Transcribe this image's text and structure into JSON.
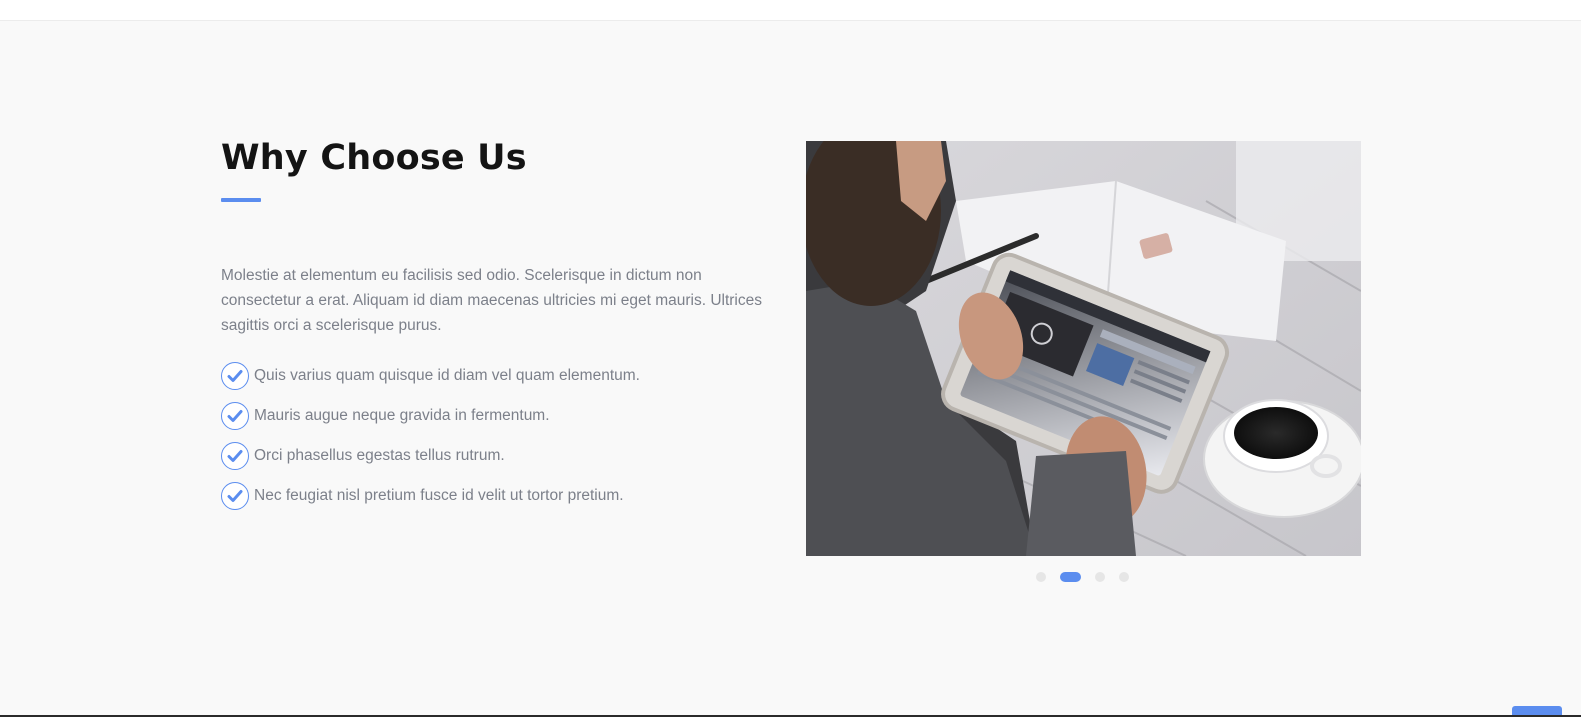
{
  "section": {
    "title": "Why Choose Us",
    "intro": "Molestie at elementum eu facilisis sed odio. Scelerisque in dictum non consectetur a erat. Aliquam id diam maecenas ultricies mi eget mauris. Ultrices sagittis orci a scelerisque purus.",
    "features": [
      "Quis varius quam quisque id diam vel quam elementum.",
      "Mauris augue neque gravida in fermentum.",
      "Orci phasellus egestas tellus rutrum.",
      "Nec feugiat nisl pretium fusce id velit ut tortor pretium."
    ]
  },
  "slider": {
    "slide_count": 4,
    "active_slide": 2
  },
  "colors": {
    "accent": "#5b8def",
    "heading": "#141414",
    "body_text": "#7c808a",
    "background": "#f9f9f9"
  },
  "icons": {
    "feature_icon": "check-circle-icon"
  }
}
